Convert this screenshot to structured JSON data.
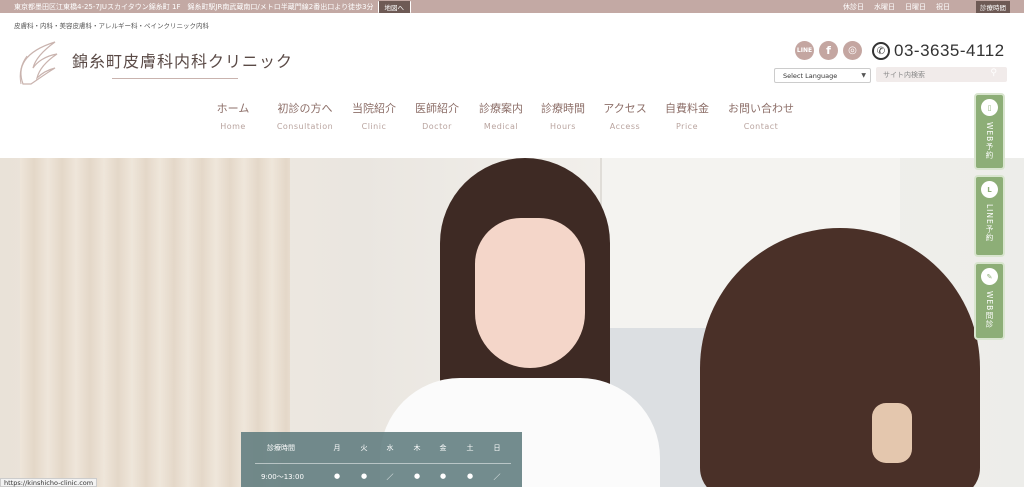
{
  "topbar": {
    "address": "東京都墨田区江東橋4-25-7JUスカイタウン錦糸町 1F　錦糸町駅JR南武蔵南口/メトロ半蔵門線2番出口より徒歩3分",
    "map_button": "地図へ",
    "closed_days": [
      "休診日",
      "水曜日",
      "日曜日",
      "祝日"
    ],
    "hours_button": "診療時間"
  },
  "subline": "皮膚科・内科・美容皮膚科・アレルギー科・ペインクリニック内科",
  "logo": {
    "name": "錦糸町皮膚科内科クリニック",
    "icon": "wing-logo-icon"
  },
  "header": {
    "social": [
      {
        "label": "LINE",
        "icon": "line-icon"
      },
      {
        "label": "f",
        "icon": "facebook-icon"
      },
      {
        "label": "◎",
        "icon": "instagram-icon"
      }
    ],
    "phone": "03-3635-4112",
    "language": "Select Language",
    "search_placeholder": "サイト内検索"
  },
  "nav": [
    {
      "jp": "ホーム",
      "en": "Home"
    },
    {
      "jp": "初診の方へ",
      "en": "Consultation"
    },
    {
      "jp": "当院紹介",
      "en": "Clinic"
    },
    {
      "jp": "医師紹介",
      "en": "Doctor"
    },
    {
      "jp": "診療案内",
      "en": "Medical"
    },
    {
      "jp": "診療時間",
      "en": "Hours"
    },
    {
      "jp": "アクセス",
      "en": "Access"
    },
    {
      "jp": "自費料金",
      "en": "Price"
    },
    {
      "jp": "お問い合わせ",
      "en": "Contact"
    }
  ],
  "hours_table": {
    "label": "診療時間",
    "days": [
      "月",
      "火",
      "水",
      "木",
      "金",
      "土",
      "日"
    ],
    "time": "9:00〜13:00",
    "marks": [
      "●",
      "●",
      "／",
      "●",
      "●",
      "●",
      "／"
    ]
  },
  "side_buttons": [
    {
      "label": "WEB予約",
      "icon": "smartphone-icon"
    },
    {
      "label": "LINE予約",
      "icon": "line-icon"
    },
    {
      "label": "WEB問診",
      "icon": "clipboard-icon"
    }
  ],
  "status_url": "https://kinshicho-clinic.com"
}
